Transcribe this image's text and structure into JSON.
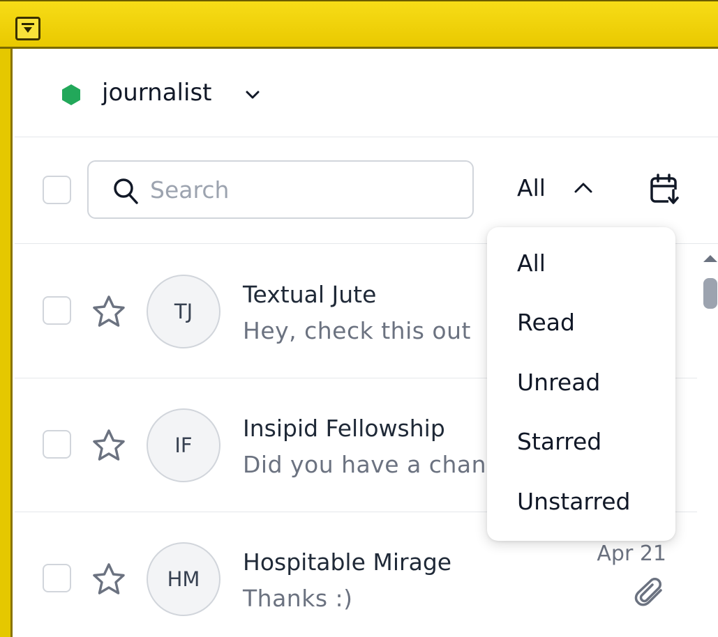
{
  "window": {
    "menu_button_icon": "window-menu-icon"
  },
  "account": {
    "name": "journalist",
    "status_color": "#22a85a"
  },
  "toolbar": {
    "search_placeholder": "Search",
    "filter_label": "All",
    "date_sort_icon": "calendar-sort-icon"
  },
  "filter_menu": {
    "options": [
      "All",
      "Read",
      "Unread",
      "Starred",
      "Unstarred"
    ]
  },
  "sources": [
    {
      "initials": "TJ",
      "name": "Textual Jute",
      "preview": "Hey, check this out",
      "date": "",
      "has_attachment": false
    },
    {
      "initials": "IF",
      "name": "Insipid Fellowship",
      "preview": "Did you have a chance",
      "date": "",
      "has_attachment": false
    },
    {
      "initials": "HM",
      "name": "Hospitable Mirage",
      "preview": "Thanks :)",
      "date": "Apr 21",
      "has_attachment": true
    }
  ],
  "colors": {
    "accent_yellow": "#efd20c",
    "border": "#d1d5db",
    "muted_text": "#6b7280"
  }
}
